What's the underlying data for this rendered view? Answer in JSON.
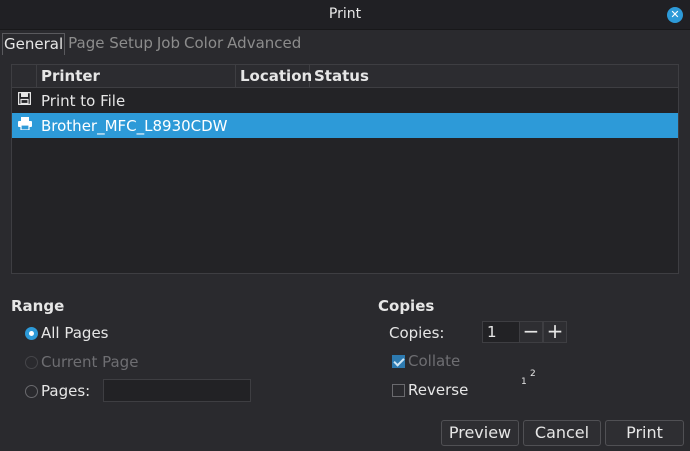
{
  "window": {
    "title": "Print"
  },
  "tabs": [
    {
      "label": "General",
      "active": true
    },
    {
      "label": "Page Setup",
      "active": false
    },
    {
      "label": "Job",
      "active": false
    },
    {
      "label": "Color",
      "active": false
    },
    {
      "label": "Advanced",
      "active": false
    }
  ],
  "printer_list": {
    "columns": [
      "Printer",
      "Location",
      "Status"
    ],
    "rows": [
      {
        "icon": "save-icon",
        "name": "Print to File",
        "location": "",
        "status": "",
        "selected": false
      },
      {
        "icon": "printer-icon",
        "name": "Brother_MFC_L8930CDW",
        "location": "",
        "status": "",
        "selected": true
      }
    ]
  },
  "range": {
    "title": "Range",
    "all_pages": "All Pages",
    "current_page": "Current Page",
    "pages": "Pages:",
    "pages_value": "",
    "selected": "all_pages"
  },
  "copies": {
    "title": "Copies",
    "label": "Copies:",
    "value": "1",
    "collate": "Collate",
    "collate_checked": true,
    "reverse": "Reverse",
    "reverse_checked": false
  },
  "buttons": {
    "preview": "Preview",
    "cancel": "Cancel",
    "print": "Print"
  },
  "colors": {
    "accent": "#2d9ad8",
    "background": "#2a2a2e"
  }
}
